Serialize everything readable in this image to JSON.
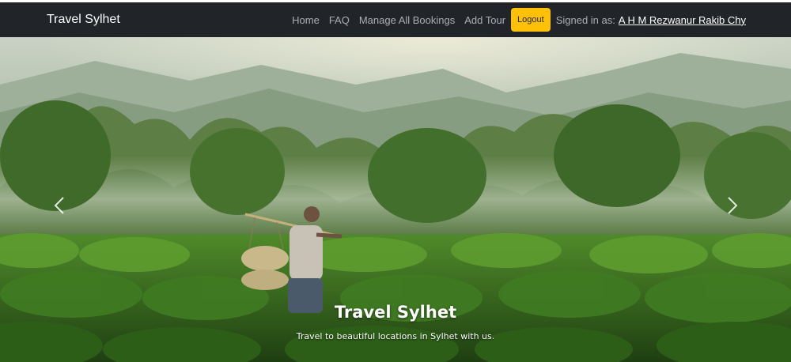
{
  "navbar": {
    "brand": "Travel Sylhet",
    "links": [
      "Home",
      "FAQ",
      "Manage All Bookings",
      "Add Tour"
    ],
    "logout_label": "Logout",
    "signed_in_label": "Signed in as:",
    "user_name": "A H M Rezwanur Rakib Chy"
  },
  "hero": {
    "title": "Travel Sylhet",
    "subtitle": "Travel to beautiful locations in Sylhet with us.",
    "prev_icon": "chevron-left-icon",
    "next_icon": "chevron-right-icon"
  },
  "colors": {
    "navbar_bg": "#212529",
    "logout_bg": "#ffc107"
  }
}
